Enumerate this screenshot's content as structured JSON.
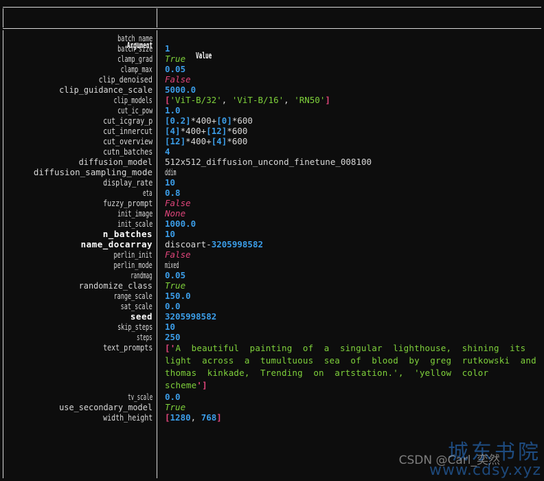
{
  "terminal": {
    "background": "#0d0d0d",
    "foreground": "#d8d8d8",
    "accent_number": "#3b9de8",
    "accent_true": "#7fd13b",
    "accent_false": "#e0457b",
    "accent_bracket": "#e0457b"
  },
  "table": {
    "header": {
      "argument": "Argument",
      "value": "Value"
    },
    "rows": [
      {
        "arg": "batch_name",
        "highlight": false,
        "value": "",
        "kind": "empty"
      },
      {
        "arg": "batch_size",
        "highlight": false,
        "value": "1",
        "kind": "num"
      },
      {
        "arg": "clamp_grad",
        "highlight": false,
        "value": "True",
        "kind": "bool-t"
      },
      {
        "arg": "clamp_max",
        "highlight": false,
        "value": "0.05",
        "kind": "num"
      },
      {
        "arg": "clip_denoised",
        "highlight": false,
        "value": "False",
        "kind": "bool-f"
      },
      {
        "arg": "clip_guidance_scale",
        "highlight": false,
        "value": "5000.0",
        "kind": "num"
      },
      {
        "arg": "clip_models",
        "highlight": false,
        "value": "['ViT-B/32', 'ViT-B/16', 'RN50']",
        "kind": "list-str"
      },
      {
        "arg": "cut_ic_pow",
        "highlight": false,
        "value": "1.0",
        "kind": "num"
      },
      {
        "arg": "cut_icgray_p",
        "highlight": false,
        "value": "[0.2]*400+[0]*600",
        "kind": "expr"
      },
      {
        "arg": "cut_innercut",
        "highlight": false,
        "value": "[4]*400+[12]*600",
        "kind": "expr"
      },
      {
        "arg": "cut_overview",
        "highlight": false,
        "value": "[12]*400+[4]*600",
        "kind": "expr"
      },
      {
        "arg": "cutn_batches",
        "highlight": false,
        "value": "4",
        "kind": "num"
      },
      {
        "arg": "diffusion_model",
        "highlight": false,
        "value": "512x512_diffusion_uncond_finetune_008100",
        "kind": "plain"
      },
      {
        "arg": "diffusion_sampling_mode",
        "highlight": false,
        "value": "ddim",
        "kind": "plain-squeeze"
      },
      {
        "arg": "display_rate",
        "highlight": false,
        "value": "10",
        "kind": "num"
      },
      {
        "arg": "eta",
        "highlight": false,
        "value": "0.8",
        "kind": "num"
      },
      {
        "arg": "fuzzy_prompt",
        "highlight": false,
        "value": "False",
        "kind": "bool-f"
      },
      {
        "arg": "init_image",
        "highlight": false,
        "value": "None",
        "kind": "none"
      },
      {
        "arg": "init_scale",
        "highlight": false,
        "value": "1000.0",
        "kind": "num"
      },
      {
        "arg": "n_batches",
        "highlight": true,
        "value": "10",
        "kind": "num"
      },
      {
        "arg": "name_docarray",
        "highlight": true,
        "value": "discoart-3205998582",
        "kind": "name-doc"
      },
      {
        "arg": "perlin_init",
        "highlight": false,
        "value": "False",
        "kind": "bool-f"
      },
      {
        "arg": "perlin_mode",
        "highlight": false,
        "value": "mixed",
        "kind": "plain-squeeze"
      },
      {
        "arg": "randmag",
        "highlight": false,
        "value": "0.05",
        "kind": "num"
      },
      {
        "arg": "randomize_class",
        "highlight": false,
        "value": "True",
        "kind": "bool-t"
      },
      {
        "arg": "range_scale",
        "highlight": false,
        "value": "150.0",
        "kind": "num"
      },
      {
        "arg": "sat_scale",
        "highlight": false,
        "value": "0.0",
        "kind": "num"
      },
      {
        "arg": "seed",
        "highlight": true,
        "value": "3205998582",
        "kind": "num"
      },
      {
        "arg": "skip_steps",
        "highlight": false,
        "value": "10",
        "kind": "num"
      },
      {
        "arg": "steps",
        "highlight": false,
        "value": "250",
        "kind": "num"
      },
      {
        "arg": "text_prompts",
        "highlight": false,
        "value": "['A beautiful painting of a singular lighthouse, shining its light across a tumultuous sea of blood by greg rutkowski and thomas kinkade, Trending on artstation.', 'yellow color scheme']",
        "kind": "prompt"
      },
      {
        "arg": "tv_scale",
        "highlight": false,
        "value": "0.0",
        "kind": "num"
      },
      {
        "arg": "use_secondary_model",
        "highlight": false,
        "value": "True",
        "kind": "bool-t"
      },
      {
        "arg": "width_height",
        "highlight": false,
        "value": "[1280, 768]",
        "kind": "list-num"
      }
    ],
    "prompt_lines": [
      "['A  beautiful  painting  of  a  singular  lighthouse,  shining  its",
      "light  across  a  tumultuous  sea  of  blood  by  greg  rutkowski  and",
      "thomas  kinkade,  Trending  on  artstation.',  'yellow  color",
      "scheme']"
    ],
    "parts": {
      "clip_models_items": [
        "'ViT-B/32'",
        "'ViT-B/16'",
        "'RN50'"
      ],
      "cut_icgray_p": {
        "a": "[0.2]",
        "b": "*400+",
        "c": "[0]",
        "d": "*600"
      },
      "cut_innercut": {
        "a": "[4]",
        "b": "*400+",
        "c": "[12]",
        "d": "*600"
      },
      "cut_overview": {
        "a": "[12]",
        "b": "*400+",
        "c": "[4]",
        "d": "*600"
      },
      "name_docarray_prefix": "discoart-",
      "name_docarray_id": "3205998582",
      "width_height": {
        "open": "[",
        "w": "1280",
        "sep": ", ",
        "h": "768",
        "close": "]"
      }
    }
  },
  "watermark": {
    "cn": "城东书院",
    "url": "www.cdsy.xyz",
    "csdn": "CSDN @Carl_奕然"
  }
}
